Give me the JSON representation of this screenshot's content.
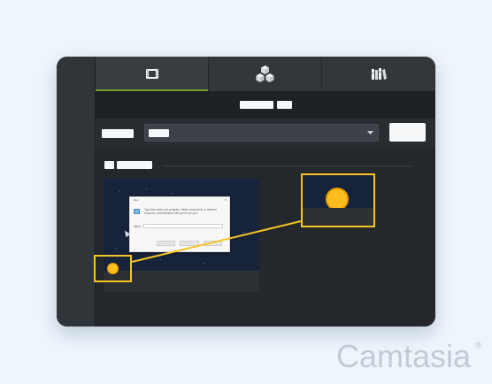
{
  "tabs": [
    {
      "icon": "film-strip-icon",
      "active": true
    },
    {
      "icon": "asset-cubes-icon",
      "active": false
    },
    {
      "icon": "library-icon",
      "active": false
    }
  ],
  "preview": {
    "dialog": {
      "title": "Run",
      "close": "×",
      "message": "Type the name of a program, folder, document, or Internet resource, and Windows will open it for you.",
      "open_label": "Open:"
    }
  },
  "brand": {
    "name": "Camtasia",
    "registered_mark": "®"
  },
  "colors": {
    "page_background": "#eef6fd",
    "app_background": "#22262b",
    "accent_green": "#739b2e",
    "highlight_yellow": "#f6c523",
    "dot_orange": "#fdbd21",
    "logo_gray": "#c4cbd6"
  }
}
